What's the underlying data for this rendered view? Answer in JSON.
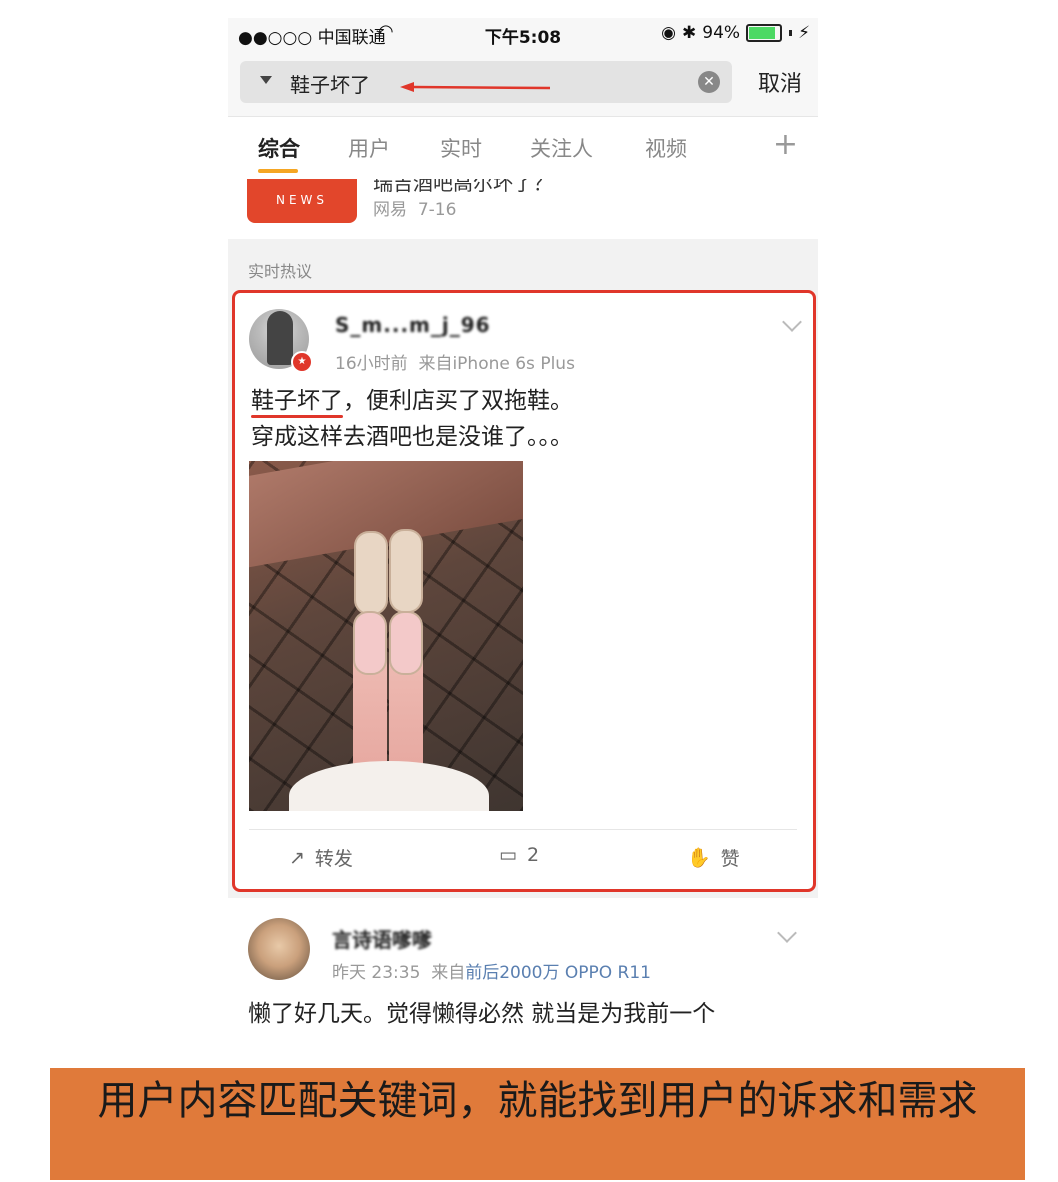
{
  "statusbar": {
    "carrier": "●●○○○ 中国联通",
    "time": "下午5:08",
    "battery": "94%",
    "battery_level": 0.94
  },
  "search": {
    "query": "鞋子坏了",
    "cancel_label": "取消",
    "clear_icon": "clear-icon"
  },
  "tabs": [
    {
      "label": "综合"
    },
    {
      "label": "用户"
    },
    {
      "label": "实时"
    },
    {
      "label": "关注人"
    },
    {
      "label": "视频"
    }
  ],
  "news": {
    "logo_text": "NEWS",
    "title_partial": "瑞吉酒吧高尔坏了？",
    "source": "网易",
    "date": "7-16"
  },
  "section_label": "实时热议",
  "post1": {
    "username": "S_m...m_j_96",
    "time": "16小时前",
    "source": "来自iPhone 6s Plus",
    "keyword": "鞋子坏了",
    "text_rest": "，便利店买了双拖鞋。",
    "text_line2": "穿成这样去酒吧也是没谁了。。。",
    "repost_label": "转发",
    "comment_count": "2",
    "like_label": "赞"
  },
  "post2": {
    "username": "言诗语嗲嗲",
    "time": "昨天 23:35",
    "source_prefix": "来自",
    "device": "前后2000万 OPPO R11",
    "text": "懒了好几天。觉得懒得必然 就当是为我前一个"
  },
  "caption": "用户内容匹配关键词，就能找到用户的诉求和需求",
  "colors": {
    "highlight_red": "#e0362a",
    "tab_accent": "#f5a623",
    "caption_bg": "#e07a3a"
  }
}
